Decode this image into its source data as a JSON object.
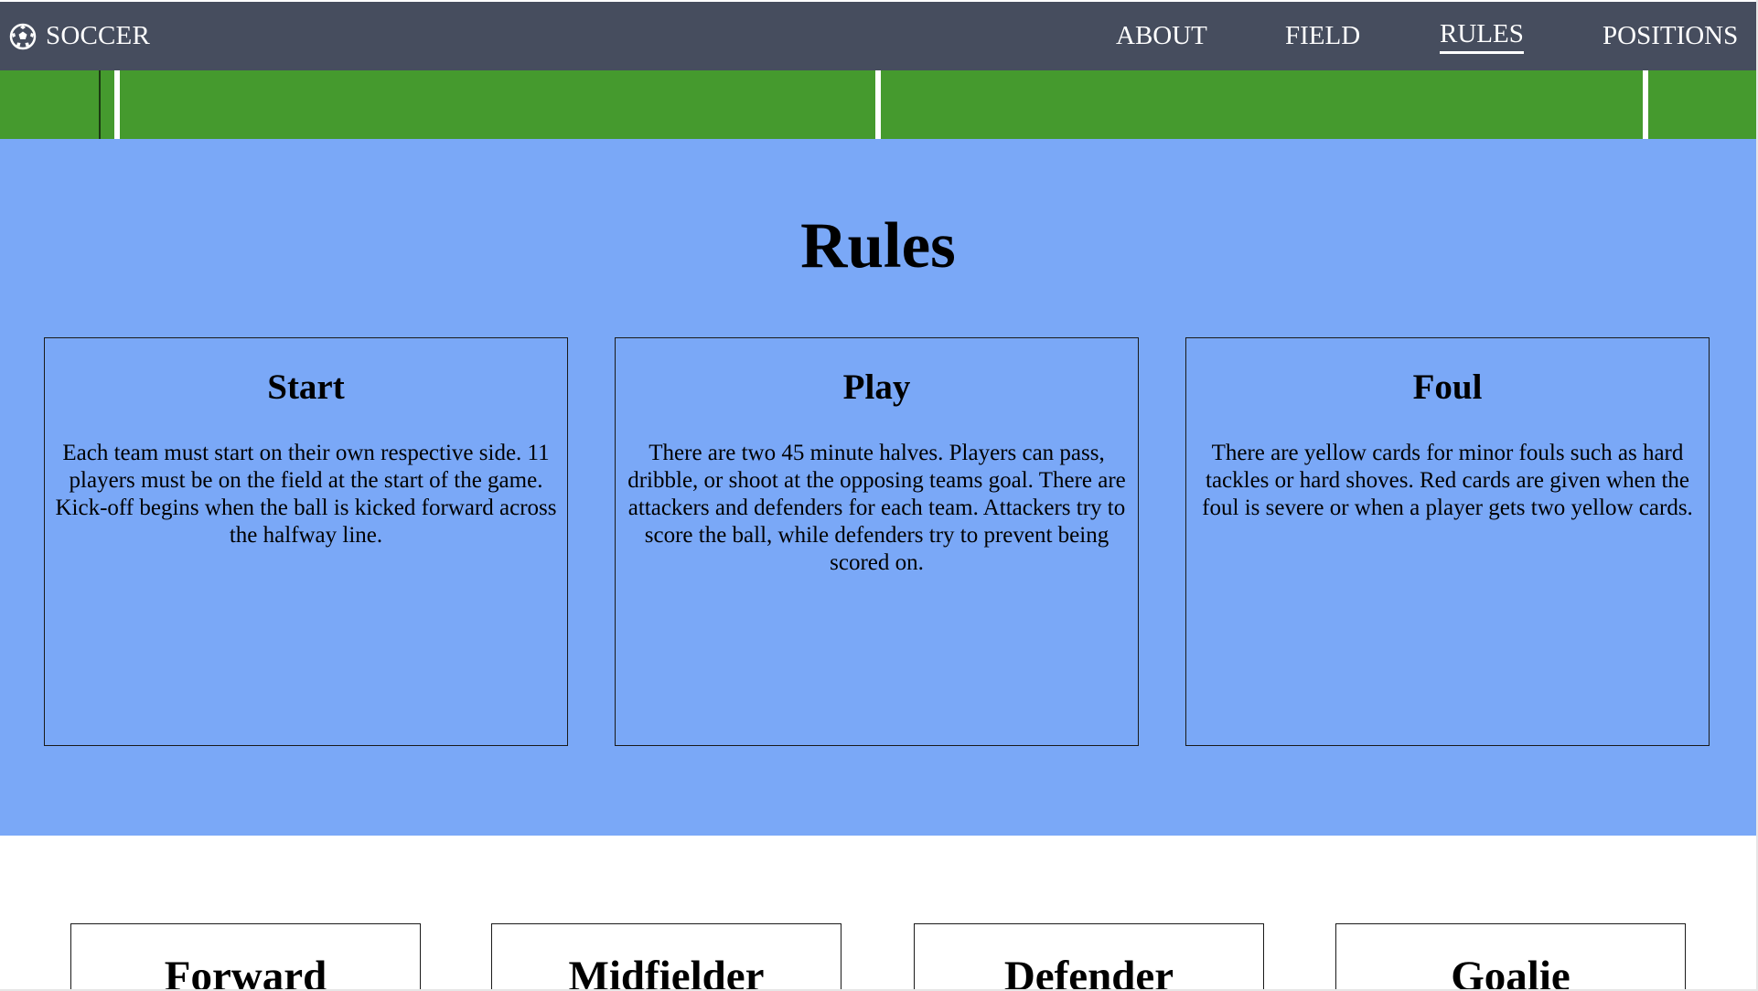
{
  "navbar": {
    "brand_label": "SOCCER",
    "brand_icon": "soccer-ball-icon",
    "links": [
      {
        "label": "ABOUT",
        "active": false
      },
      {
        "label": "FIELD",
        "active": false
      },
      {
        "label": "RULES",
        "active": true
      },
      {
        "label": "POSITIONS",
        "active": false
      }
    ],
    "background_color": "#464d5e"
  },
  "field_strip": {
    "color": "#459a2e",
    "line_color": "#ffffff"
  },
  "rules": {
    "title": "Rules",
    "background_color": "#7aa8f7",
    "cards": [
      {
        "heading": "Start",
        "text": "Each team must start on their own respective side. 11 players must be on the field at the start of the game. Kick-off begins when the ball is kicked forward across the halfway line."
      },
      {
        "heading": "Play",
        "text": "There are two 45 minute halves. Players can pass, dribble, or shoot at the opposing teams goal. There are attackers and defenders for each team. Attackers try to score the ball, while defenders try to prevent being scored on."
      },
      {
        "heading": "Foul",
        "text": "There are yellow cards for minor fouls such as hard tackles or hard shoves. Red cards are given when the foul is severe or when a player gets two yellow cards."
      }
    ]
  },
  "positions": {
    "cards": [
      {
        "heading": "Forward"
      },
      {
        "heading": "Midfielder"
      },
      {
        "heading": "Defender"
      },
      {
        "heading": "Goalie"
      }
    ]
  }
}
